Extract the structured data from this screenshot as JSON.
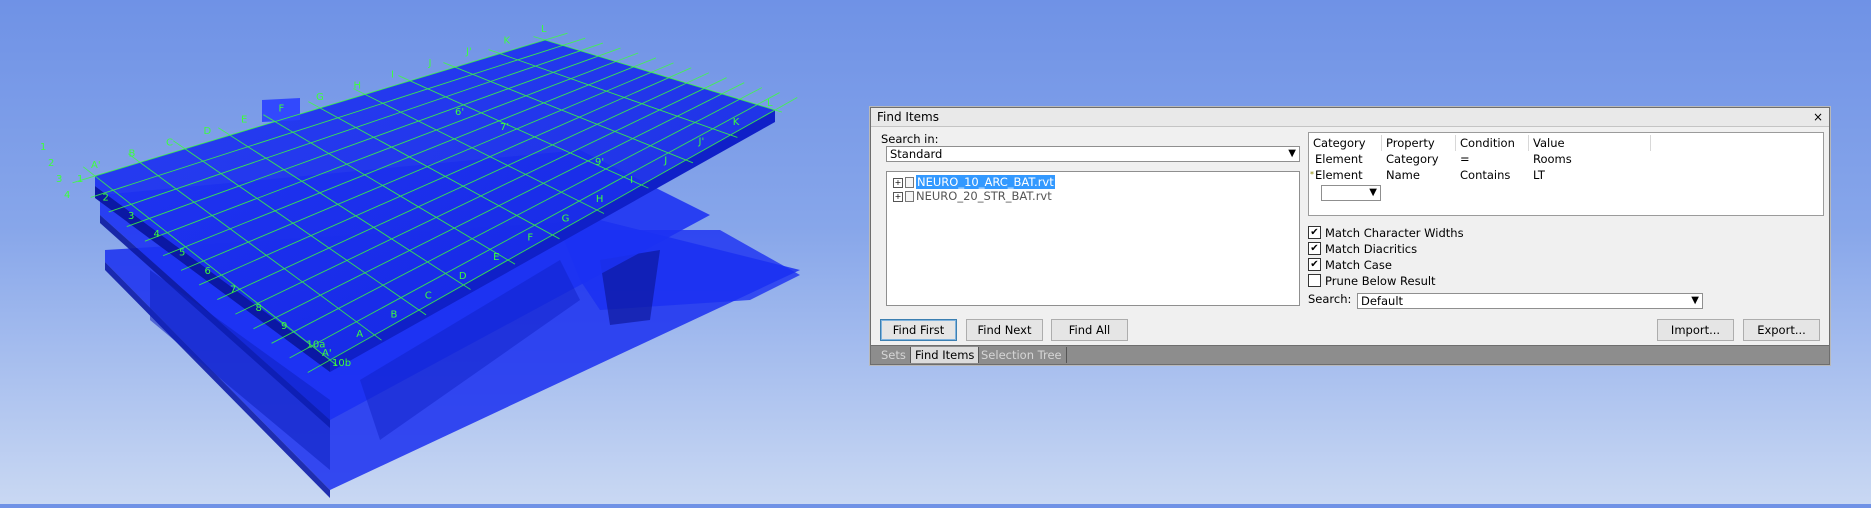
{
  "viewport": {
    "top_grid_letters": [
      "A'",
      "B",
      "C",
      "D",
      "E",
      "F",
      "G",
      "H",
      "I",
      "J",
      "J'",
      "K",
      "L"
    ],
    "top_grid_numbers": [
      "1",
      "2",
      "3",
      "4"
    ],
    "side_numbers": [
      "1",
      "2",
      "3",
      "4",
      "5",
      "6",
      "7",
      "8",
      "9",
      "10a",
      "10b"
    ],
    "side_letters": [
      "A'",
      "A",
      "B",
      "C",
      "D",
      "E",
      "F",
      "G",
      "H",
      "I",
      "J",
      "J'",
      "K",
      "L"
    ],
    "inner_labels": [
      "6'",
      "7'",
      "9'"
    ],
    "model_color": "#1c32f2",
    "grid_color": "#3cff3c"
  },
  "find_items": {
    "title": "Find Items",
    "close_glyph": "×",
    "search_in_label": "Search in:",
    "search_in_value": "Standard",
    "tree": [
      {
        "label": "NEURO_10_ARC_BAT.rvt",
        "selected": true,
        "expander": "+"
      },
      {
        "label": "NEURO_20_STR_BAT.rvt",
        "selected": false,
        "expander": "+"
      }
    ],
    "grid": {
      "headers": [
        "Category",
        "Property",
        "Condition",
        "Value"
      ],
      "rows": [
        {
          "category": "Element",
          "property": "Category",
          "condition": "=",
          "value": "Rooms"
        },
        {
          "category": "Element",
          "property": "Name",
          "condition": "Contains",
          "value": "LT"
        }
      ],
      "row_marker": "*"
    },
    "options": [
      {
        "label": "Match Character Widths",
        "checked": true
      },
      {
        "label": "Match Diacritics",
        "checked": true
      },
      {
        "label": "Match Case",
        "checked": true
      },
      {
        "label": "Prune Below Result",
        "checked": false
      }
    ],
    "check_glyph": "✔",
    "search_label": "Search:",
    "search_value": "Default",
    "buttons": {
      "find_first": "Find First",
      "find_next": "Find Next",
      "find_all": "Find All",
      "import": "Import...",
      "export": "Export..."
    },
    "tabs": [
      "Sets",
      "Find Items",
      "Selection Tree"
    ],
    "active_tab": "Find Items"
  }
}
